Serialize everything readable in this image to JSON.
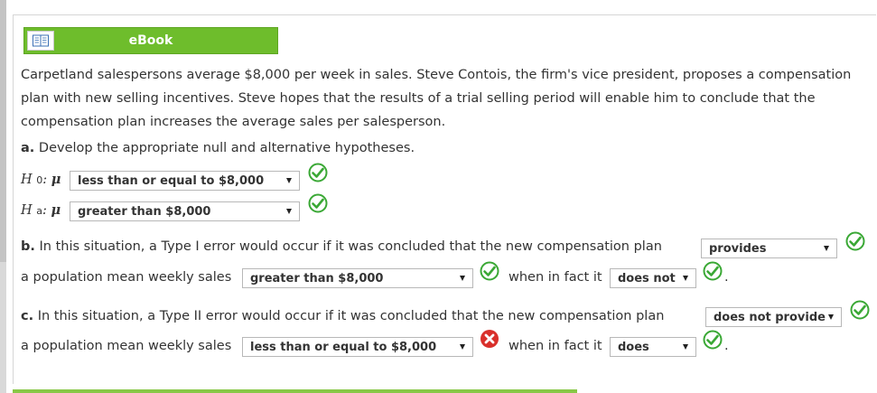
{
  "ebook": {
    "label": "eBook",
    "icon": "book-icon"
  },
  "problem": {
    "text": "Carpetland salespersons average $8,000 per week in sales. Steve Contois, the firm's vice president, proposes a compensation plan with new selling incentives. Steve hopes that the results of a trial selling period will enable him to conclude that the compensation plan increases the average sales per salesperson."
  },
  "part_a": {
    "label": "a.",
    "text": "Develop the appropriate null and alternative hypotheses.",
    "h0": {
      "h": "H",
      "sub": "0",
      "colon": ":",
      "mu": "μ",
      "value": "less than or equal to $8,000",
      "status": "correct"
    },
    "ha": {
      "h": "H",
      "sub": "a",
      "colon": ":",
      "mu": "μ",
      "value": "greater than $8,000",
      "status": "correct"
    }
  },
  "part_b": {
    "label": "b.",
    "text": "In this situation, a Type I error would occur if it was concluded that the new compensation plan",
    "select1": {
      "value": "provides",
      "status": "correct"
    },
    "line2_prefix": "a population mean weekly sales",
    "select2": {
      "value": "greater than $8,000",
      "status": "correct"
    },
    "line2_mid": "when in fact it",
    "select3": {
      "value": "does not",
      "status": "correct"
    },
    "end": "."
  },
  "part_c": {
    "label": "c.",
    "text": "In this situation, a Type II error would occur if it was concluded that the new compensation plan",
    "select1": {
      "value": "does not provide",
      "status": "correct"
    },
    "line2_prefix": "a population mean weekly sales",
    "select2": {
      "value": "less than or equal to $8,000",
      "status": "incorrect"
    },
    "line2_mid": "when in fact it",
    "select3": {
      "value": "does",
      "status": "correct"
    },
    "end": "."
  },
  "colors": {
    "accent_green": "#6ebd2c",
    "check_green": "#3aa835",
    "error_red": "#d9302b"
  }
}
